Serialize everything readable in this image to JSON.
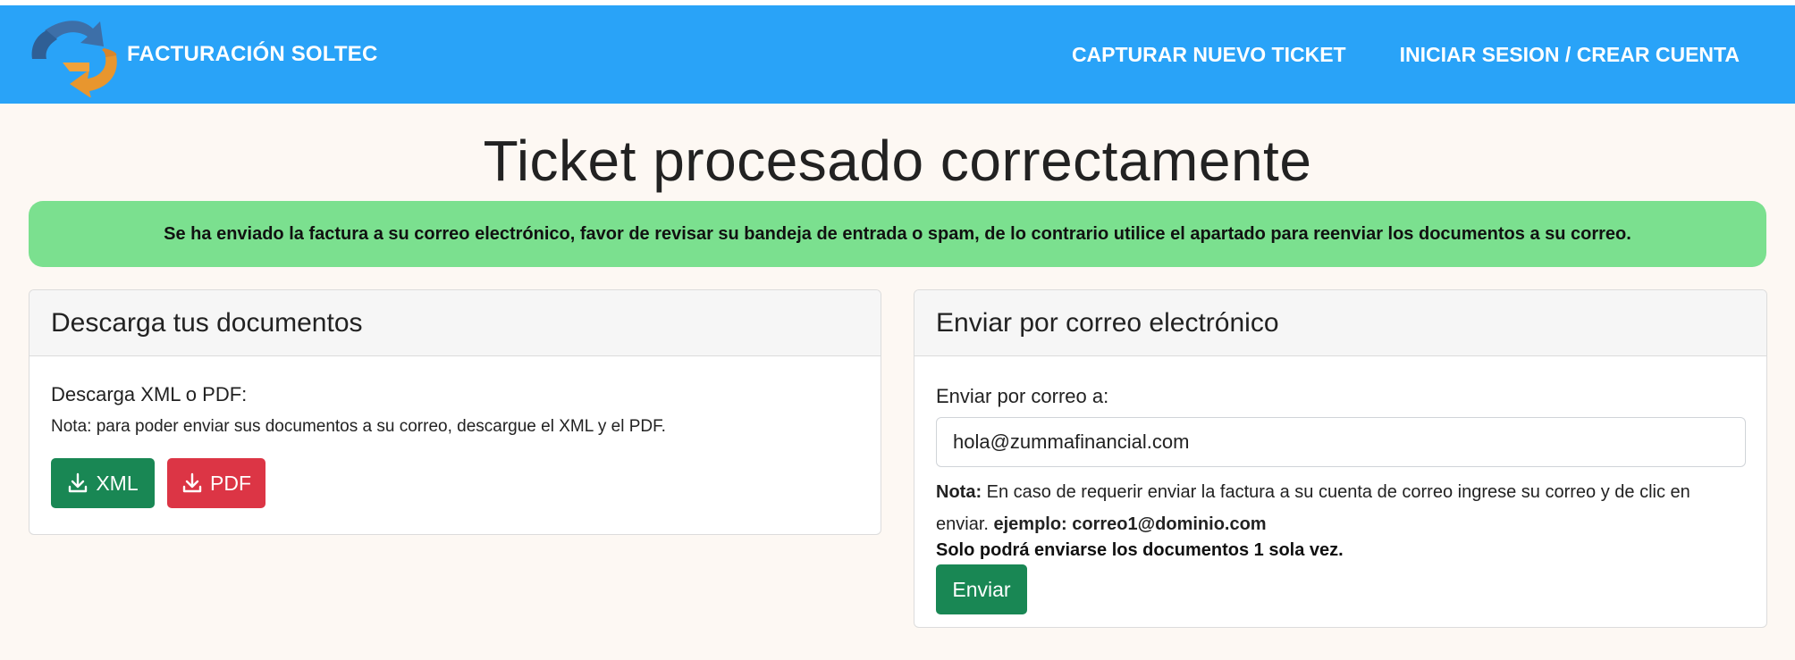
{
  "navbar": {
    "brand": "FACTURACIÓN SOLTEC",
    "links": [
      "CAPTURAR NUEVO TICKET",
      "INICIAR SESION / CREAR CUENTA"
    ]
  },
  "main": {
    "title": "Ticket procesado correctamente",
    "alert": "Se ha enviado la factura a su correo electrónico, favor de revisar su bandeja de entrada o spam, de lo contrario utilice el apartado para reenviar los documentos a su correo."
  },
  "download": {
    "header": "Descarga tus documentos",
    "label": "Descarga XML o PDF:",
    "note": "Nota: para poder enviar sus documentos a su correo, descargue el XML y el PDF.",
    "xml_button": "XML",
    "pdf_button": "PDF"
  },
  "email": {
    "header": "Enviar por correo electrónico",
    "label": "Enviar por correo a:",
    "value": "hola@zummafinancial.com",
    "note_prefix": "Nota:",
    "note_text": " En caso de requerir enviar la factura a su cuenta de correo ingrese su correo y de clic en enviar. ",
    "example": "ejemplo: correo1@dominio.com",
    "once": "Solo podrá enviarse los documentos 1 sola vez.",
    "send_button": "Enviar"
  },
  "colors": {
    "navbar": "#29a3f8",
    "alert": "#7be08f",
    "success": "#198754",
    "danger": "#dc3545",
    "background": "#fdf8f3"
  },
  "icons": {
    "logo": "soltec-arrows-logo",
    "download": "download-icon"
  }
}
